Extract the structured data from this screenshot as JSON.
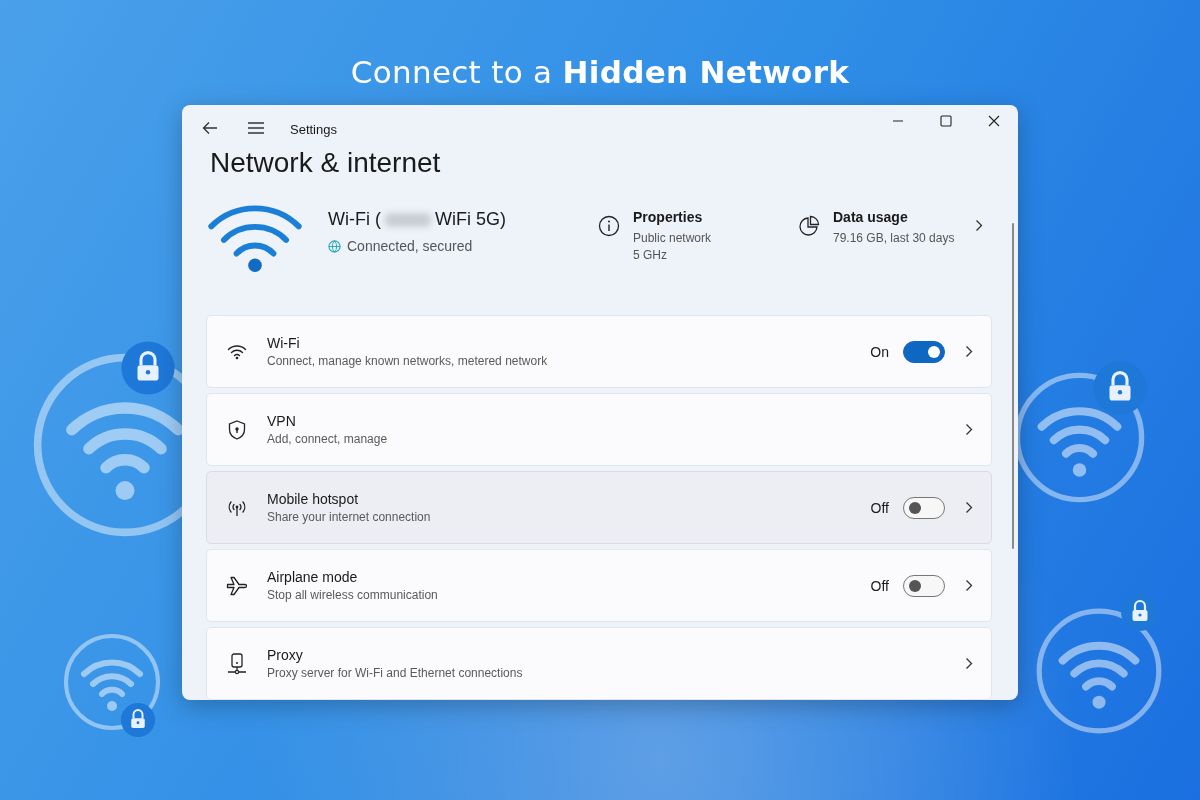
{
  "headline": "Connect to a **Hidden Network**",
  "window": {
    "title": "Settings",
    "heading": "Network & internet"
  },
  "connection": {
    "name_start": "Wi-Fi (",
    "name_end": "WiFi 5G)",
    "status": "Connected, secured",
    "properties": {
      "title": "Properties",
      "lines": [
        "Public network",
        "5 GHz"
      ]
    },
    "data_usage": {
      "title": "Data usage",
      "detail": "79.16 GB, last 30 days"
    }
  },
  "rows": [
    {
      "kind": "toggle",
      "title": "Wi-Fi",
      "subtitle": "Connect, manage known networks, metered network",
      "on": true,
      "state_label": "On",
      "selected": false
    },
    {
      "kind": "link",
      "title": "VPN",
      "subtitle": "Add, connect, manage",
      "selected": false
    },
    {
      "kind": "toggle",
      "title": "Mobile hotspot",
      "subtitle": "Share your internet connection",
      "on": false,
      "state_label": "Off",
      "selected": true
    },
    {
      "kind": "toggle",
      "title": "Airplane mode",
      "subtitle": "Stop all wireless communication",
      "on": false,
      "state_label": "Off",
      "selected": false
    },
    {
      "kind": "link",
      "title": "Proxy",
      "subtitle": "Proxy server for Wi-Fi and Ethernet connections",
      "selected": false
    }
  ]
}
